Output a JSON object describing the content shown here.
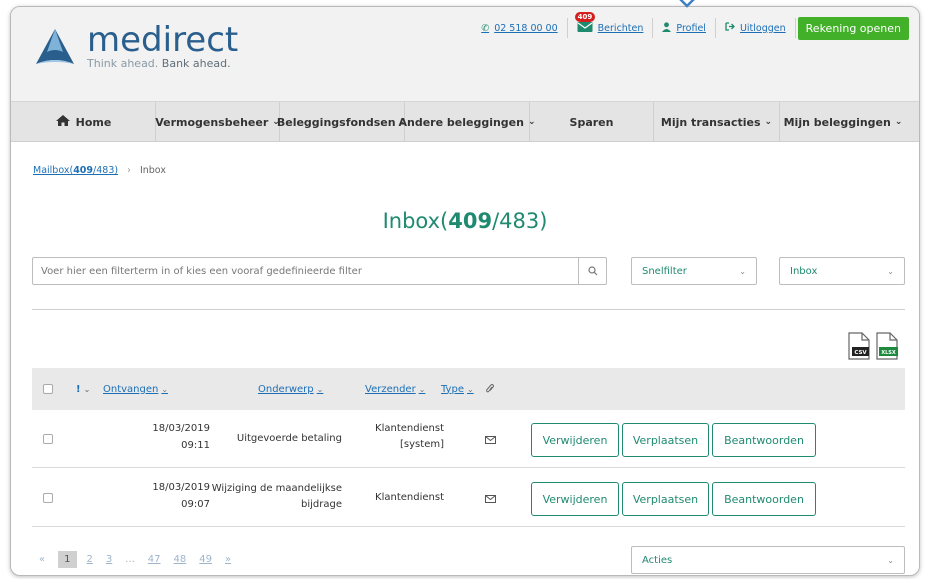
{
  "header": {
    "logo_name_part1": "me",
    "logo_name_part2": "direct",
    "logo_tag_part1": "Think ahead. ",
    "logo_tag_part2": "Bank ahead.",
    "phone": "02 518 00 00",
    "messages_badge": "409",
    "messages_label": "Berichten",
    "profile_label": "Profiel",
    "logout_label": "Uitloggen",
    "open_account_label": "Rekening openen"
  },
  "nav": {
    "items": [
      {
        "label": "Home"
      },
      {
        "label": "Vermogensbeheer"
      },
      {
        "label": "Beleggingsfondsen"
      },
      {
        "label": "Andere beleggingen"
      },
      {
        "label": "Sparen"
      },
      {
        "label": "Mijn transacties"
      },
      {
        "label": "Mijn beleggingen"
      }
    ]
  },
  "breadcrumb": {
    "mailbox_prefix": "Mailbox(",
    "mailbox_unread": "409",
    "mailbox_total": "/483)",
    "current": "Inbox"
  },
  "page": {
    "title_prefix": "Inbox(",
    "title_unread": "409",
    "title_suffix": "/483)"
  },
  "filter": {
    "placeholder": "Voer hier een filterterm in of kies een vooraf gedefinieerde filter",
    "quickfilter_label": "Snelfilter",
    "folder_label": "Inbox"
  },
  "exports": {
    "csv": "CSV",
    "xlsx": "XLSX"
  },
  "table": {
    "headers": {
      "priority": "!",
      "received": "Ontvangen",
      "subject": "Onderwerp",
      "sender": "Verzender",
      "type": "Type"
    },
    "rows": [
      {
        "date": "18/03/2019",
        "time": "09:11",
        "subject_line1": "Uitgevoerde betaling",
        "subject_line2": "",
        "sender_line1": "Klantendienst",
        "sender_line2": "[system]"
      },
      {
        "date": "18/03/2019",
        "time": "09:07",
        "subject_line1": "Wijziging de maandelijkse",
        "subject_line2": "bijdrage",
        "sender_line1": "Klantendienst",
        "sender_line2": ""
      }
    ],
    "actions": {
      "delete": "Verwijderen",
      "move": "Verplaatsen",
      "reply": "Beantwoorden"
    }
  },
  "pagination": {
    "prev": "«",
    "pages": [
      "1",
      "2",
      "3",
      "...",
      "47",
      "48",
      "49"
    ],
    "next": "»",
    "current": "1"
  },
  "bulk_actions_label": "Acties",
  "colors": {
    "brand_blue": "#2a5f8d",
    "accent_green": "#1f8a70",
    "button_green": "#43b02a",
    "link_blue": "#1d6fb5",
    "badge_red": "#d41f1f"
  }
}
